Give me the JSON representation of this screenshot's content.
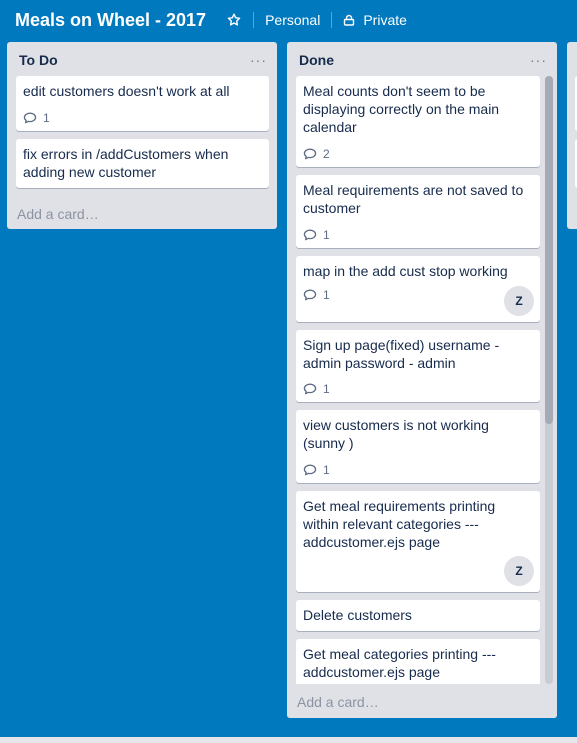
{
  "header": {
    "board_title": "Meals on Wheel - 2017",
    "team": "Personal",
    "visibility": "Private"
  },
  "lists": [
    {
      "title": "To Do",
      "menu": "···",
      "add_card": "Add a card…",
      "cards": [
        {
          "title": "edit customers doesn't work at all",
          "comments": "1"
        },
        {
          "title": "fix errors in /addCustomers when adding new customer"
        }
      ]
    },
    {
      "title": "Done",
      "menu": "···",
      "add_card": "Add a card…",
      "cards": [
        {
          "title": "Meal counts don't seem to be displaying correctly on the main calendar",
          "comments": "2"
        },
        {
          "title": "Meal requirements are not saved to customer",
          "comments": "1"
        },
        {
          "title": "map in the add cust stop working",
          "comments": "1",
          "member": "Z"
        },
        {
          "title": "Sign up page(fixed) username - admin password - admin",
          "comments": "1"
        },
        {
          "title": "view customers is not working (sunny )",
          "comments": "1"
        },
        {
          "title": "Get meal requirements printing within relevant categories --- addcustomer.ejs page",
          "member": "Z"
        },
        {
          "title": "Delete customers"
        },
        {
          "title": "Get meal categories printing --- addcustomer.ejs page"
        }
      ]
    }
  ],
  "icons": {
    "star": "star-icon",
    "lock": "lock-icon",
    "comment": "comment-icon"
  },
  "colors": {
    "board_background": "#0079bf",
    "list_background": "#dfe1e6",
    "card_background": "#ffffff"
  }
}
